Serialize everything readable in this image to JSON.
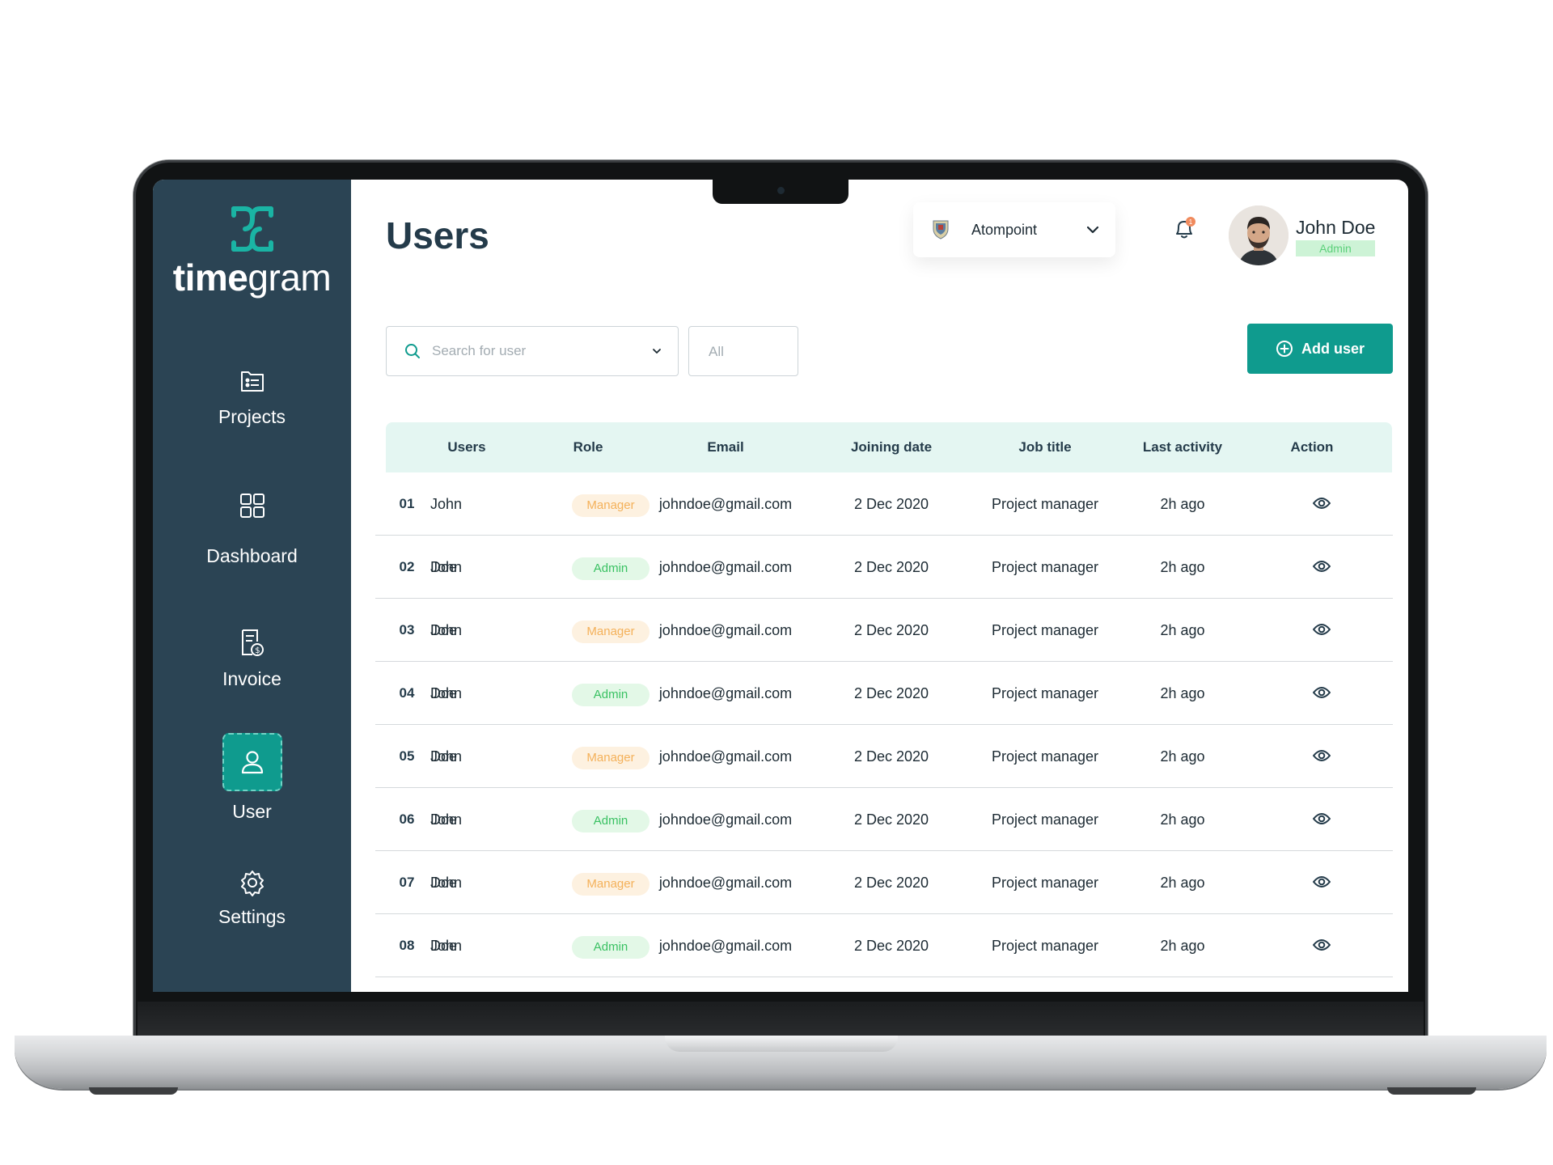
{
  "app": {
    "logo_prefix": "time",
    "logo_suffix": "gram"
  },
  "sidebar": {
    "items": [
      {
        "label": "Projects",
        "icon": "projects-icon"
      },
      {
        "label": "Dashboard",
        "icon": "dashboard-icon"
      },
      {
        "label": "Invoice",
        "icon": "invoice-icon"
      },
      {
        "label": "User",
        "icon": "user-icon",
        "active": true
      },
      {
        "label": "Settings",
        "icon": "gear-icon"
      }
    ]
  },
  "header": {
    "title": "Users",
    "organization": "Atompoint",
    "notification_count": "1",
    "profile": {
      "name": "John Doe",
      "role": "Admin"
    }
  },
  "toolbar": {
    "search_placeholder": "Search for user",
    "filter_value": "All",
    "add_label": "Add user"
  },
  "table": {
    "columns": [
      "Users",
      "Role",
      "Email",
      "Joining date",
      "Job title",
      "Last activity",
      "Action"
    ],
    "rows": [
      {
        "num": "01",
        "name": "John Doe",
        "role": "Manager",
        "email": "johndoe@gmail.com",
        "date": "2 Dec 2020",
        "job": "Project manager",
        "activity": "2h ago"
      },
      {
        "num": "02",
        "name": "John Doe",
        "role": "Admin",
        "email": "johndoe@gmail.com",
        "date": "2 Dec 2020",
        "job": "Project manager",
        "activity": "2h ago"
      },
      {
        "num": "03",
        "name": "John Doe",
        "role": "Manager",
        "email": "johndoe@gmail.com",
        "date": "2 Dec 2020",
        "job": "Project manager",
        "activity": "2h ago"
      },
      {
        "num": "04",
        "name": "John Doe",
        "role": "Admin",
        "email": "johndoe@gmail.com",
        "date": "2 Dec 2020",
        "job": "Project manager",
        "activity": "2h ago"
      },
      {
        "num": "05",
        "name": "John Doe",
        "role": "Manager",
        "email": "johndoe@gmail.com",
        "date": "2 Dec 2020",
        "job": "Project manager",
        "activity": "2h ago"
      },
      {
        "num": "06",
        "name": "John Doe",
        "role": "Admin",
        "email": "johndoe@gmail.com",
        "date": "2 Dec 2020",
        "job": "Project manager",
        "activity": "2h ago"
      },
      {
        "num": "07",
        "name": "John Doe",
        "role": "Manager",
        "email": "johndoe@gmail.com",
        "date": "2 Dec 2020",
        "job": "Project manager",
        "activity": "2h ago"
      },
      {
        "num": "08",
        "name": "John Doe",
        "role": "Admin",
        "email": "johndoe@gmail.com",
        "date": "2 Dec 2020",
        "job": "Project manager",
        "activity": "2h ago"
      }
    ]
  },
  "colors": {
    "sidebar": "#2b4454",
    "accent": "#0f9b8e",
    "table_header": "#e4f6f2",
    "manager_badge": "#f4b15a",
    "admin_badge": "#39c162"
  }
}
